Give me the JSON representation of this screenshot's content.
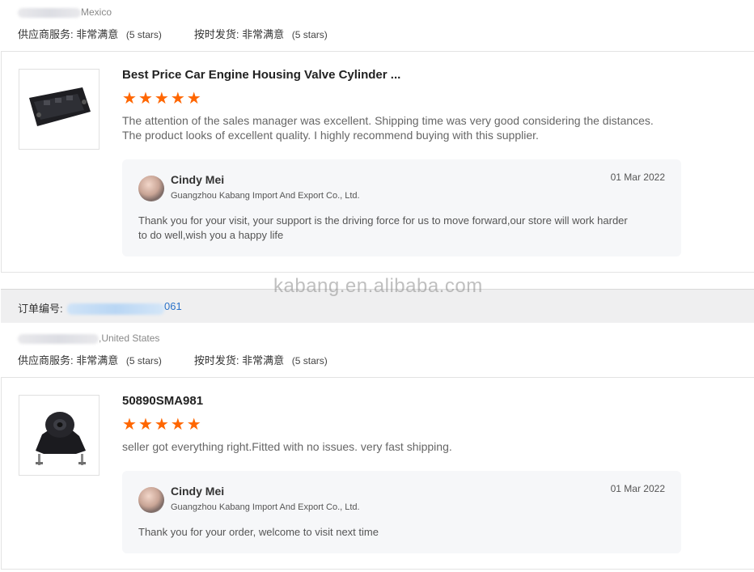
{
  "top_section": {
    "buyer_country": "Mexico",
    "ratings": [
      {
        "label": "供应商服务:",
        "value": "非常满意",
        "stars": "(5 stars)"
      },
      {
        "label": "按时发货:",
        "value": "非常满意",
        "stars": "(5 stars)"
      }
    ]
  },
  "reviews": [
    {
      "product_title": "Best Price Car Engine Housing Valve Cylinder ...",
      "rating": 5,
      "review_lines": [
        "The attention of the sales manager was excellent. Shipping time was very good considering the distances.",
        "The product looks of excellent quality. I highly recommend buying with this supplier."
      ],
      "reply": {
        "name": "Cindy Mei",
        "company": "Guangzhou Kabang Import And Export Co., Ltd.",
        "date": "01 Mar 2022",
        "text_lines": [
          "Thank you for your visit, your support is the driving force for us to move forward,our store will work harder",
          "to do well,wish you a happy life"
        ]
      }
    },
    {
      "product_title": "50890SMA981",
      "rating": 5,
      "review_lines": [
        "seller got everything right.Fitted with no issues. very fast shipping."
      ],
      "reply": {
        "name": "Cindy Mei",
        "company": "Guangzhou Kabang Import And Export Co., Ltd.",
        "date": "01 Mar 2022",
        "text_lines": [
          "Thank you for your order, welcome to visit next time"
        ]
      }
    }
  ],
  "order_bar": {
    "label": "订单编号:",
    "number_suffix": "061"
  },
  "second_section": {
    "buyer_country": ",United States",
    "ratings": [
      {
        "label": "供应商服务:",
        "value": "非常满意",
        "stars": "(5 stars)"
      },
      {
        "label": "按时发货:",
        "value": "非常满意",
        "stars": "(5 stars)"
      }
    ]
  },
  "watermark": "kabang.en.alibaba.com",
  "colors": {
    "star": "#ff6600",
    "link": "#2a72c9",
    "reply_bg": "#f6f7f9",
    "order_bar_bg": "#efeff0"
  },
  "icons": {
    "star": "star-icon",
    "avatar": "seller-avatar"
  }
}
